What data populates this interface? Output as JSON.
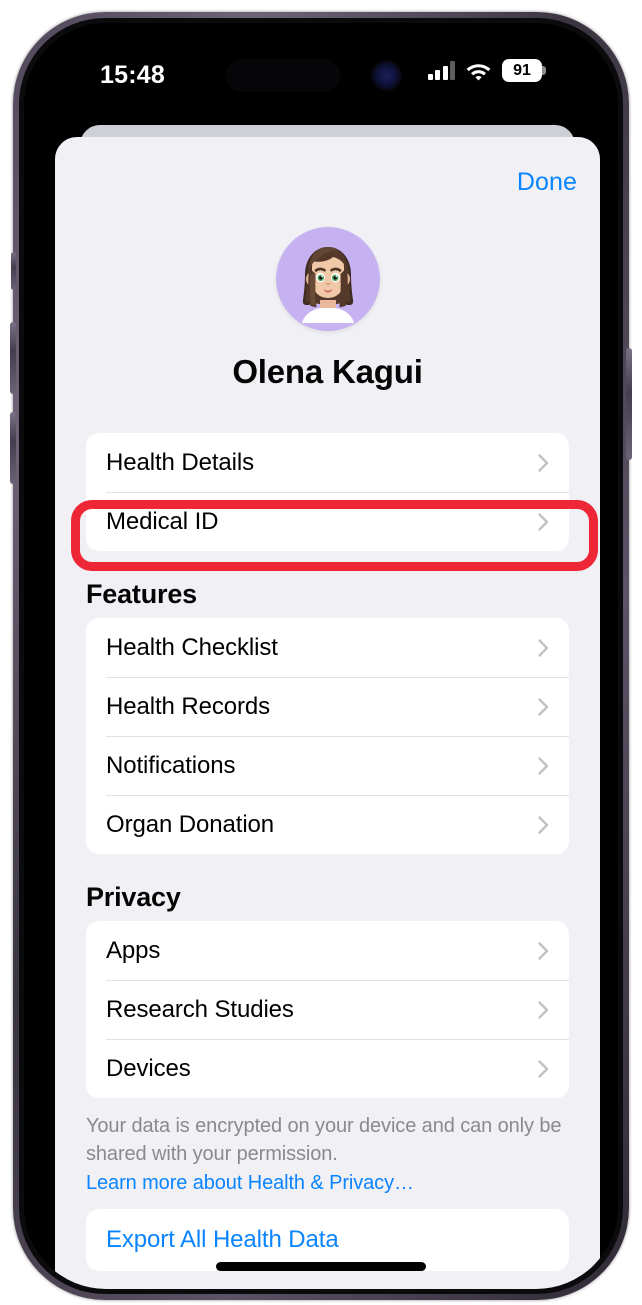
{
  "status_bar": {
    "time": "15:48",
    "battery_level": "91",
    "icons": [
      "cellular-signal-icon",
      "wifi-icon",
      "battery-icon"
    ]
  },
  "sheet": {
    "done_label": "Done",
    "profile_name": "Olena Kagui",
    "avatar_icon": "memoji-avatar",
    "avatar_bg_color": "#C6B2F0"
  },
  "groups": [
    {
      "header": "",
      "items": [
        {
          "label": "Health Details",
          "accessory": "chevron-right-icon"
        },
        {
          "label": "Medical ID",
          "accessory": "chevron-right-icon",
          "highlighted": true
        }
      ]
    },
    {
      "header": "Features",
      "items": [
        {
          "label": "Health Checklist",
          "accessory": "chevron-right-icon"
        },
        {
          "label": "Health Records",
          "accessory": "chevron-right-icon"
        },
        {
          "label": "Notifications",
          "accessory": "chevron-right-icon"
        },
        {
          "label": "Organ Donation",
          "accessory": "chevron-right-icon"
        }
      ]
    },
    {
      "header": "Privacy",
      "items": [
        {
          "label": "Apps",
          "accessory": "chevron-right-icon"
        },
        {
          "label": "Research Studies",
          "accessory": "chevron-right-icon"
        },
        {
          "label": "Devices",
          "accessory": "chevron-right-icon"
        }
      ]
    }
  ],
  "footer": {
    "text": "Your data is encrypted on your device and can only be shared with your permission.",
    "link": "Learn more about Health & Privacy…",
    "export_label": "Export All Health Data"
  },
  "annotation": {
    "type": "highlight-rectangle",
    "target": "Medical ID",
    "color": "#EE2737"
  },
  "colors": {
    "accent_blue": "#0A84FF",
    "sheet_background": "#F1F1F5",
    "card_background": "#FFFFFF",
    "secondary_text": "#8A8A8E"
  }
}
